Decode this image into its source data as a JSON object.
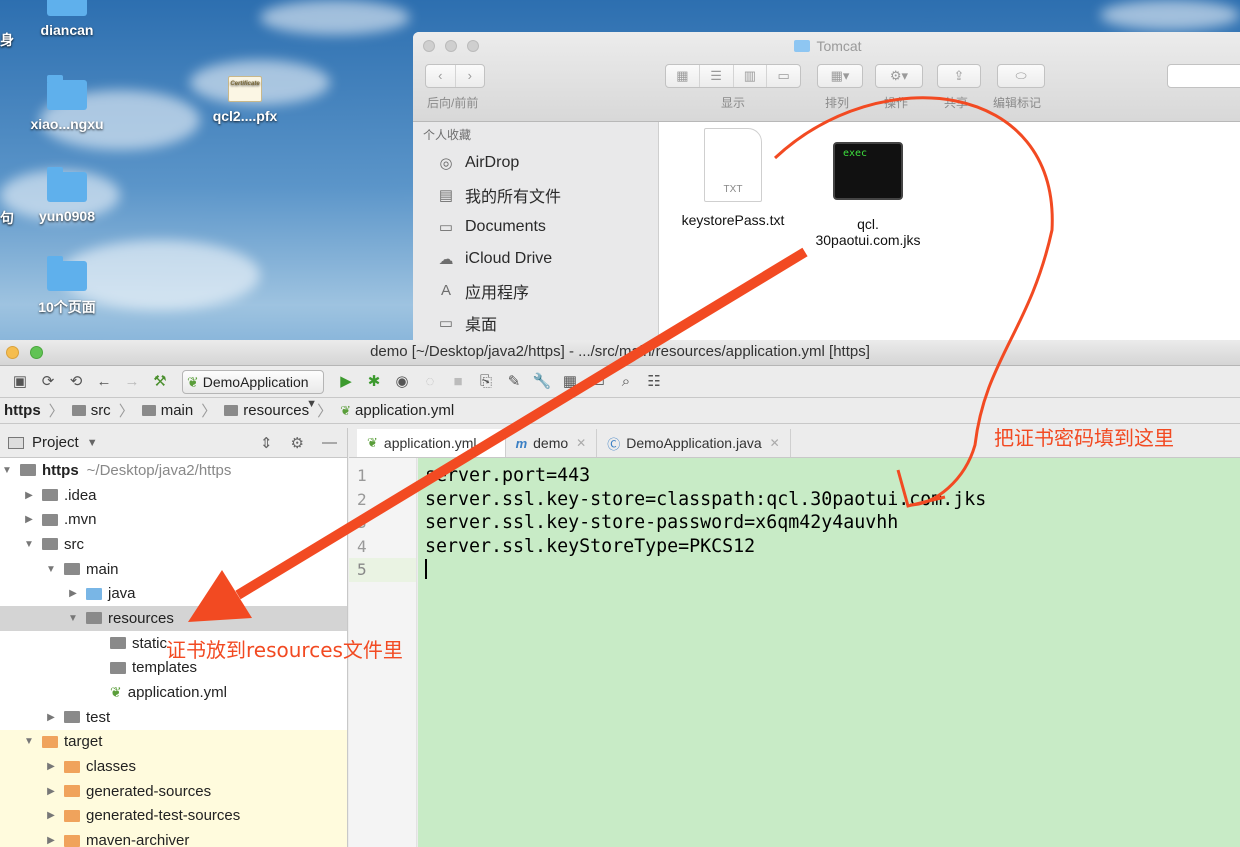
{
  "desktop": {
    "icons": [
      {
        "label": "diancan"
      },
      {
        "label": "xiao...ngxu"
      },
      {
        "label": "qcl2....pfx"
      },
      {
        "label": "yun0908"
      },
      {
        "label": "10个页面"
      }
    ],
    "edge_fragments": [
      "身",
      "句"
    ]
  },
  "finder": {
    "title": "Tomcat",
    "toolbar_labels": {
      "back_forward": "后向/前前",
      "view": "显示",
      "arrange": "排列",
      "action": "操作",
      "share": "共享",
      "tags": "编辑标记"
    },
    "sidebar_heading": "个人收藏",
    "sidebar_items": [
      {
        "label": "AirDrop",
        "icon": "airdrop-icon"
      },
      {
        "label": "我的所有文件",
        "icon": "all-files-icon"
      },
      {
        "label": "Documents",
        "icon": "folder-icon"
      },
      {
        "label": "iCloud Drive",
        "icon": "cloud-icon"
      },
      {
        "label": "应用程序",
        "icon": "applications-icon"
      },
      {
        "label": "桌面",
        "icon": "desktop-icon"
      }
    ],
    "files": [
      {
        "name": "keystorePass.txt",
        "kind": "TXT"
      },
      {
        "name_line1": "qcl.",
        "name_line2": "30paotui.com.jks",
        "badge": "exec"
      }
    ]
  },
  "ide": {
    "title": "demo [~/Desktop/java2/https] - .../src/main/resources/application.yml [https]",
    "run_config": "DemoApplication",
    "breadcrumbs": [
      "https",
      "src",
      "main",
      "resources",
      "application.yml"
    ],
    "project_label": "Project",
    "tree": [
      {
        "label": "https",
        "path": "~/Desktop/java2/https"
      },
      {
        "label": ".idea"
      },
      {
        "label": ".mvn"
      },
      {
        "label": "src"
      },
      {
        "label": "main"
      },
      {
        "label": "java"
      },
      {
        "label": "resources"
      },
      {
        "label": "static"
      },
      {
        "label": "templates"
      },
      {
        "label": "application.yml"
      },
      {
        "label": "test"
      },
      {
        "label": "target"
      },
      {
        "label": "classes"
      },
      {
        "label": "generated-sources"
      },
      {
        "label": "generated-test-sources"
      },
      {
        "label": "maven-archiver"
      }
    ],
    "tabs": [
      {
        "label": "application.yml"
      },
      {
        "label": "demo"
      },
      {
        "label": "DemoApplication.java"
      }
    ],
    "line_numbers": [
      "1",
      "2",
      "3",
      "4",
      "5"
    ],
    "code_lines": [
      "server.port=443",
      "server.ssl.key-store=classpath:qcl.30paotui.com.jks",
      "server.ssl.key-store-password=x6qm42y4auvhh",
      "server.ssl.keyStoreType=PKCS12",
      ""
    ]
  },
  "annotations": {
    "password_note": "把证书密码填到这里",
    "resources_note": "证书放到resources文件里",
    "color": "#f24a22"
  }
}
